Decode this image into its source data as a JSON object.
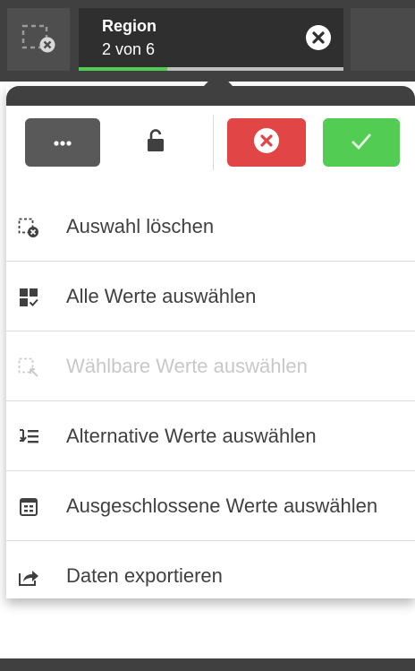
{
  "selection_bar": {
    "clear_all_icon": "clear-selections-icon",
    "chip": {
      "field": "Region",
      "status": "2 von 6",
      "selected_fraction": 0.333,
      "bar_color": "#52cc52",
      "close_icon": "close-circle-icon"
    }
  },
  "toolbar": {
    "more_icon": "more-options-icon",
    "lock_icon": "unlock-icon",
    "cancel_icon": "cancel-circle-icon",
    "cancel_color": "#e14545",
    "confirm_icon": "checkmark-icon",
    "confirm_color": "#52cc52"
  },
  "menu": {
    "items": [
      {
        "label": "Auswahl löschen",
        "icon": "clear-selection-icon",
        "enabled": true
      },
      {
        "label": "Alle Werte auswählen",
        "icon": "select-all-icon",
        "enabled": true
      },
      {
        "label": "Wählbare Werte auswählen",
        "icon": "select-possible-icon",
        "enabled": false
      },
      {
        "label": "Alternative Werte auswählen",
        "icon": "select-alternative-icon",
        "enabled": true
      },
      {
        "label": "Ausgeschlossene Werte auswählen",
        "icon": "select-excluded-icon",
        "enabled": true
      },
      {
        "label": "Daten exportieren",
        "icon": "export-icon",
        "enabled": true
      }
    ]
  }
}
